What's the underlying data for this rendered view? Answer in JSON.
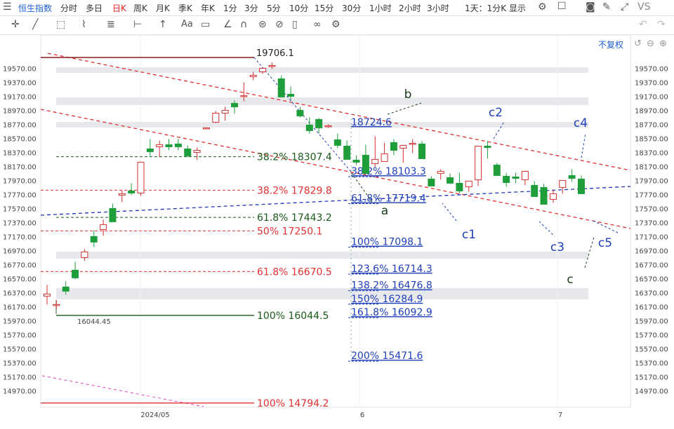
{
  "topbar": {
    "menu_icon": "menu-icon",
    "instrument": "恒生指数",
    "periods": [
      "分时",
      "多日",
      "日K",
      "周K",
      "月K",
      "季K",
      "年K",
      "1分",
      "3分",
      "5分",
      "10分",
      "15分",
      "30分",
      "1小时",
      "2小时",
      "3小时"
    ],
    "active_period": "日K",
    "display_label": "1天：1分K 显示",
    "vs_label": "VS"
  },
  "adjust_label": "不复权",
  "colors": {
    "up": "#d03030",
    "down": "#1e9e3a",
    "fib_red": "#e03030",
    "fib_blue": "#1f3fb8",
    "fib_green": "#1a5a1a",
    "band": "#e6e8ec",
    "tl_blue": "#2233bb"
  },
  "chart_data": {
    "type": "candlestick",
    "y_axis": {
      "ticks": [
        19570,
        19370,
        19170,
        18970,
        18770,
        18570,
        18370,
        18170,
        17970,
        17770,
        17570,
        17370,
        17170,
        16970,
        16770,
        16570,
        16370,
        16170,
        15970,
        15770,
        15570,
        15370,
        15170,
        14970
      ]
    },
    "x_labels": [
      "2024/05",
      "6",
      "7"
    ],
    "candles": [
      [
        16320,
        16480,
        16200,
        16350
      ],
      [
        16200,
        16260,
        16130,
        16200
      ],
      [
        16450,
        16530,
        16340,
        16390
      ],
      [
        16690,
        16810,
        16560,
        16580
      ],
      [
        16870,
        16990,
        16820,
        16950
      ],
      [
        17170,
        17260,
        17020,
        17090
      ],
      [
        17270,
        17410,
        17180,
        17340
      ],
      [
        17570,
        17640,
        17380,
        17380
      ],
      [
        17760,
        17830,
        17660,
        17780
      ],
      [
        17820,
        17930,
        17760,
        17790
      ],
      [
        17790,
        18220,
        17750,
        18230
      ],
      [
        18420,
        18560,
        18310,
        18380
      ],
      [
        18450,
        18540,
        18300,
        18480
      ],
      [
        18480,
        18560,
        18400,
        18450
      ],
      [
        18490,
        18560,
        18400,
        18450
      ],
      [
        18420,
        18470,
        18300,
        18320
      ],
      [
        18370,
        18440,
        18260,
        18400
      ],
      [
        18710,
        18720,
        18700,
        18720
      ],
      [
        18800,
        18960,
        18790,
        18930
      ],
      [
        18930,
        19020,
        18820,
        18970
      ],
      [
        19070,
        19110,
        18920,
        19020
      ],
      [
        19180,
        19370,
        19100,
        19180
      ],
      [
        19450,
        19520,
        19400,
        19470
      ],
      [
        19520,
        19580,
        19490,
        19570
      ],
      [
        19600,
        19650,
        19560,
        19610
      ],
      [
        19420,
        19470,
        19200,
        19160
      ],
      [
        19200,
        19310,
        19120,
        19170
      ],
      [
        18970,
        19020,
        18870,
        18890
      ],
      [
        18760,
        18870,
        18640,
        18680
      ],
      [
        18840,
        18860,
        18640,
        18720
      ],
      [
        18740,
        18770,
        18720,
        18750
      ],
      [
        18550,
        18640,
        18430,
        18470
      ],
      [
        18460,
        18540,
        18290,
        18270
      ],
      [
        18260,
        18330,
        18190,
        18230
      ],
      [
        18330,
        18480,
        18250,
        18070
      ],
      [
        18210,
        18600,
        18160,
        18270
      ],
      [
        18240,
        18510,
        18240,
        18350
      ],
      [
        18510,
        18560,
        18330,
        18400
      ],
      [
        18430,
        18480,
        18220,
        18470
      ],
      [
        18500,
        18560,
        18360,
        18500
      ],
      [
        18490,
        18530,
        18310,
        18280
      ],
      [
        17990,
        18030,
        17890,
        17890
      ],
      [
        18070,
        18130,
        17980,
        18100
      ],
      [
        18010,
        18070,
        17920,
        17930
      ],
      [
        17930,
        18080,
        17790,
        17820
      ],
      [
        17880,
        17960,
        17810,
        17960
      ],
      [
        17980,
        18100,
        17890,
        18460
      ],
      [
        18460,
        18530,
        18280,
        18440
      ],
      [
        18190,
        18220,
        18060,
        18040
      ],
      [
        18030,
        18080,
        17880,
        17940
      ],
      [
        18020,
        18080,
        17930,
        18000
      ],
      [
        17980,
        18110,
        17900,
        18100
      ],
      [
        17900,
        17960,
        17760,
        17740
      ],
      [
        17870,
        17920,
        17720,
        17630
      ],
      [
        17700,
        17840,
        17650,
        17780
      ],
      [
        17870,
        17950,
        17780,
        17970
      ],
      [
        18040,
        18130,
        17950,
        18000
      ],
      [
        17990,
        18040,
        17920,
        17780
      ]
    ],
    "fib_levels": [
      {
        "pct": "38.2%",
        "value": "18307.4",
        "price": 18307.4,
        "color": "#1a5a1a"
      },
      {
        "pct": "38.2%",
        "value": "17829.8",
        "price": 17829.8,
        "color": "#e03030"
      },
      {
        "pct": "61.8%",
        "value": "17443.2",
        "price": 17443.2,
        "color": "#1a5a1a"
      },
      {
        "pct": "50%",
        "value": "17250.1",
        "price": 17250.1,
        "color": "#e03030"
      },
      {
        "pct": "61.8%",
        "value": "16670.5",
        "price": 16670.5,
        "color": "#e03030"
      },
      {
        "pct": "100%",
        "value": "16044.5",
        "price": 16044.5,
        "color": "#1a5a1a"
      },
      {
        "pct": "100%",
        "value": "14794.2",
        "price": 14794.2,
        "color": "#e03030"
      }
    ],
    "ext_levels": [
      {
        "pct": "38.2%",
        "value": "18103.3",
        "price": 18103.3
      },
      {
        "pct": "61.8%",
        "value": "17719.4",
        "price": 17719.4
      },
      {
        "pct": "100%",
        "value": "17098.1",
        "price": 17098.1
      },
      {
        "pct": "123.6%",
        "value": "16714.3",
        "price": 16714.3
      },
      {
        "pct": "138.2%",
        "value": "16476.8",
        "price": 16476.8
      },
      {
        "pct": "150%",
        "value": "16284.9",
        "price": 16284.9
      },
      {
        "pct": "161.8%",
        "value": "16092.9",
        "price": 16092.9
      },
      {
        "pct": "200%",
        "value": "15471.6",
        "price": 15471.6
      }
    ],
    "ext_top": "18724.6",
    "top_label": "19706.1",
    "low_label": "16044.45",
    "wave_labels": [
      "a",
      "b",
      "c",
      "c1",
      "c2",
      "c3",
      "c4",
      "c5"
    ]
  }
}
